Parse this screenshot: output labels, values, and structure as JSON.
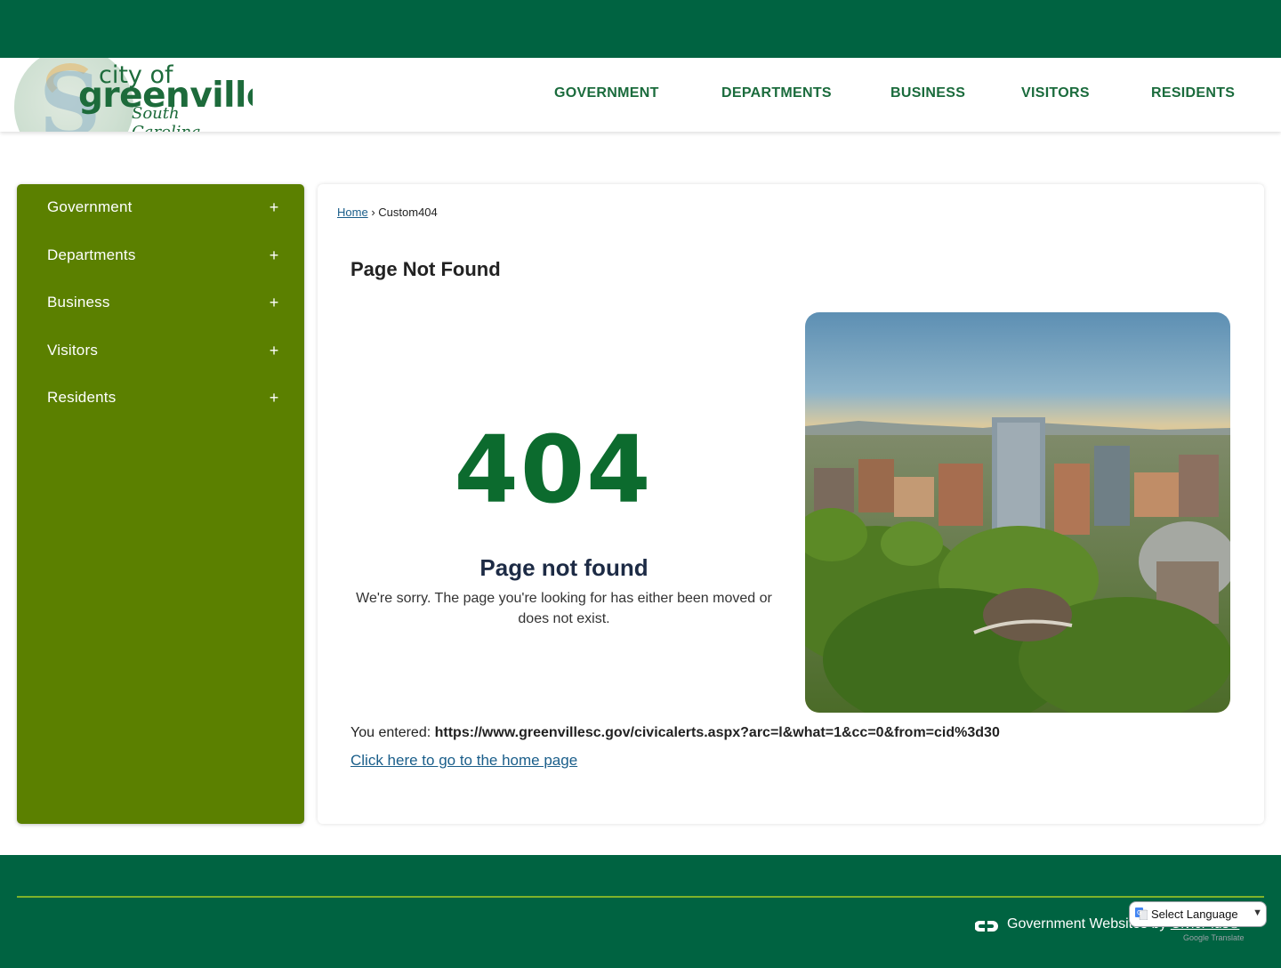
{
  "header": {
    "logo": {
      "line1": "city of",
      "line2": "greenville",
      "line3": "South Carolina"
    },
    "nav": [
      "GOVERNMENT",
      "DEPARTMENTS",
      "BUSINESS",
      "VISITORS",
      "RESIDENTS"
    ]
  },
  "sidebar": {
    "items": [
      {
        "label": "Government",
        "icon": "+"
      },
      {
        "label": "Departments",
        "icon": "+"
      },
      {
        "label": "Business",
        "icon": "+"
      },
      {
        "label": "Visitors",
        "icon": "+"
      },
      {
        "label": "Residents",
        "icon": "+"
      }
    ]
  },
  "breadcrumb": {
    "home": "Home",
    "separator": "›",
    "current": "Custom404"
  },
  "main": {
    "title": "Page Not Found",
    "code": "404",
    "heading": "Page not found",
    "message": "We're sorry. The page you're looking for has either been moved or does not exist.",
    "entered_label": "You entered:",
    "entered_url": "https://www.greenvillesc.gov/civicalerts.aspx?arc=l&what=1&cc=0&from=cid%3d30",
    "home_link": "Click here to go to the home page"
  },
  "footer": {
    "credit_text": "Government Websites by",
    "credit_link": "CivicPlus®"
  },
  "translate": {
    "label": "Select Language",
    "powered": "Google Translate"
  },
  "colors": {
    "dark_green": "#006341",
    "sidebar_green": "#5b8000",
    "nav_green": "#1a6b3c",
    "code_green": "#0c6b2e",
    "link_blue": "#1a5e8a"
  }
}
